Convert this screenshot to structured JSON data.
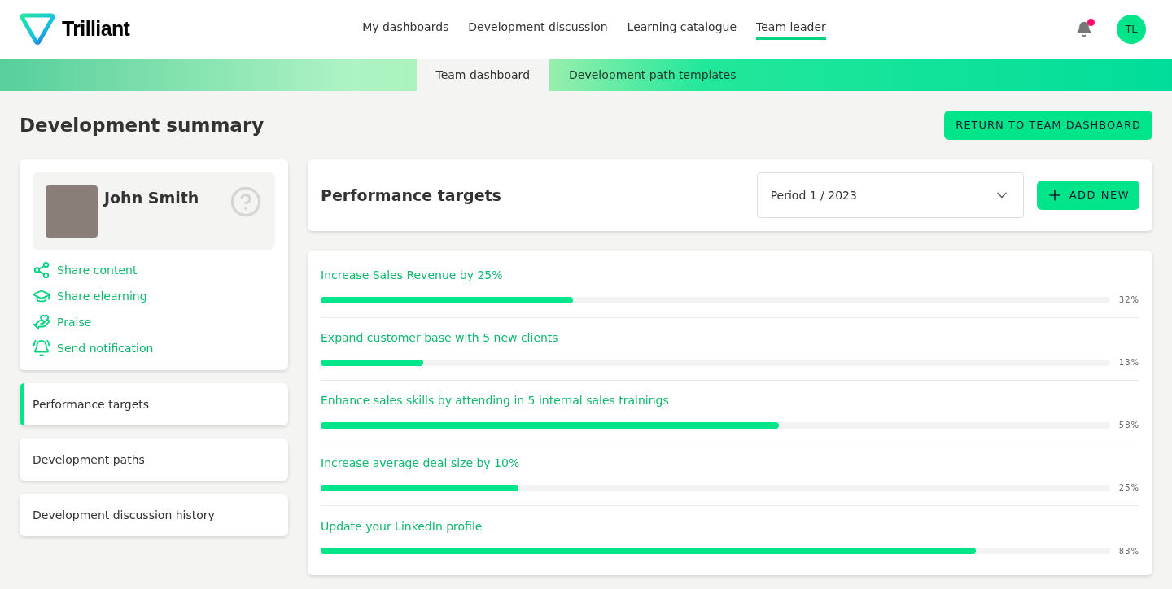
{
  "brand": {
    "name": "Trilliant"
  },
  "nav": [
    {
      "label": "My dashboards",
      "selected": false
    },
    {
      "label": "Development discussion",
      "selected": false
    },
    {
      "label": "Learning catalogue",
      "selected": false
    },
    {
      "label": "Team leader",
      "selected": true
    }
  ],
  "notifications": {
    "unread": true
  },
  "user": {
    "initials": "TL"
  },
  "subtabs": [
    {
      "label": "Team dashboard",
      "selected": true
    },
    {
      "label": "Development path templates",
      "selected": false
    }
  ],
  "page": {
    "title": "Development summary",
    "action": "RETURN TO TEAM DASHBOARD"
  },
  "profile": {
    "name": "John Smith",
    "actions": [
      {
        "kind": "share",
        "label": "Share content"
      },
      {
        "kind": "elearning",
        "label": "Share elearning"
      },
      {
        "kind": "praise",
        "label": "Praise"
      },
      {
        "kind": "notify",
        "label": "Send notification"
      }
    ]
  },
  "sections": [
    {
      "label": "Performance targets",
      "selected": true
    },
    {
      "label": "Development paths",
      "selected": false
    },
    {
      "label": "Development discussion history",
      "selected": false
    }
  ],
  "targets": {
    "title": "Performance targets",
    "period": "Period 1 / 2023",
    "add_button": "ADD NEW",
    "items": [
      {
        "label": "Increase Sales Revenue by 25%",
        "level": 0.32,
        "reading": "32%"
      },
      {
        "label": "Expand customer base with 5 new clients",
        "level": 0.13,
        "reading": "13%"
      },
      {
        "label": "Enhance sales skills by attending in 5 internal sales trainings",
        "level": 0.58,
        "reading": "58%"
      },
      {
        "label": "Increase average deal size by 10%",
        "level": 0.25,
        "reading": "25%"
      },
      {
        "label": "Update your LinkedIn profile",
        "level": 0.83,
        "reading": "83%"
      }
    ]
  }
}
